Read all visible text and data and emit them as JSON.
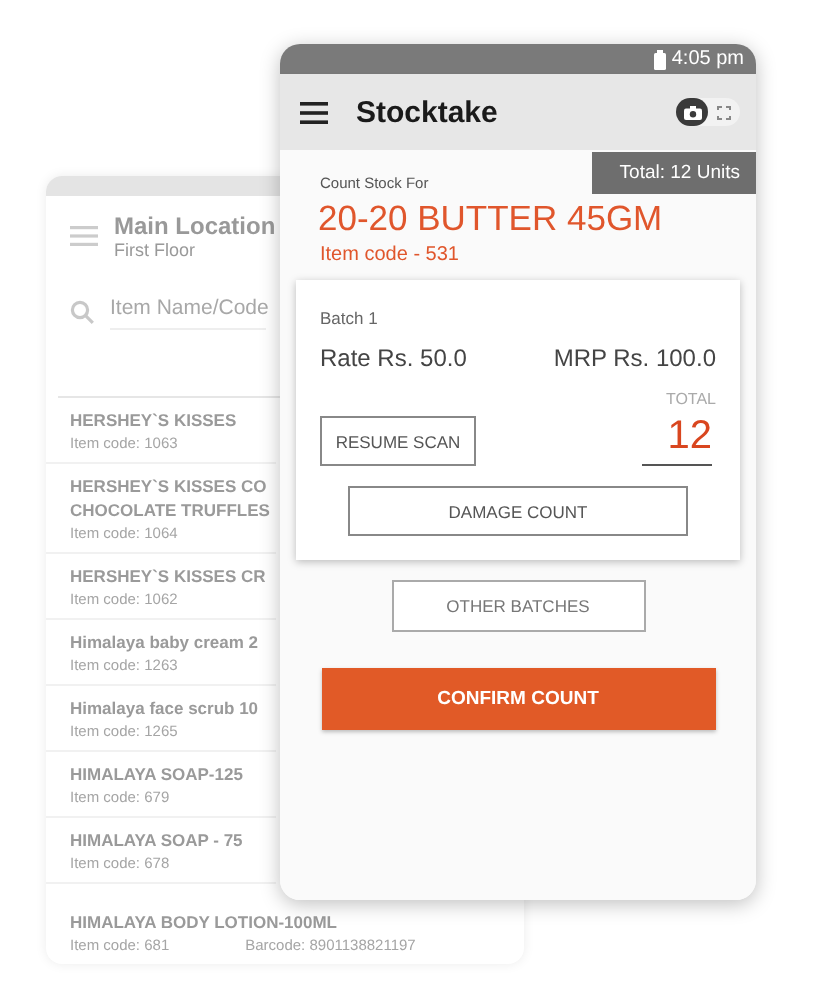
{
  "back_screen": {
    "title": "Main Location",
    "subtitle": "First Floor",
    "search": {
      "placeholder": "Item Name/Code"
    },
    "items": [
      {
        "name": "HERSHEY`S KISSES",
        "code": "Item code: 1063"
      },
      {
        "name": "HERSHEY`S KISSES CO",
        "name_line_2": "CHOCOLATE TRUFFLES",
        "code": "Item code: 1064"
      },
      {
        "name": "HERSHEY`S KISSES CR",
        "code": "Item code: 1062"
      },
      {
        "name": "Himalaya baby cream 2",
        "code": "Item code: 1263"
      },
      {
        "name": "Himalaya face scrub 10",
        "code": "Item code: 1265"
      },
      {
        "name": "HIMALAYA  SOAP-125",
        "code": "Item code: 679"
      },
      {
        "name": "HIMALAYA  SOAP - 75",
        "code": "Item code: 678"
      },
      {
        "name": "HIMALAYA  BODY LOTION-100ML",
        "code": "Item code: 681",
        "barcode": "Barcode: 8901138821197"
      }
    ]
  },
  "status_bar": {
    "time": "4:05 pm"
  },
  "app_bar": {
    "title": "Stocktake",
    "mode_toggle": [
      {
        "kind": "camera",
        "selected": true
      },
      {
        "kind": "scanner",
        "selected": false
      }
    ]
  },
  "total_badge": "Total: 12 Units",
  "item": {
    "caption": "Count Stock For",
    "name": "20-20 BUTTER 45GM",
    "code": "Item code - 531"
  },
  "batch_card": {
    "batch": "Batch 1",
    "rate": "Rate Rs. 50.0",
    "mrp": "MRP Rs. 100.0",
    "total_label": "TOTAL",
    "resume_button": "RESUME SCAN",
    "count_value": "12",
    "damage_button": "DAMAGE COUNT"
  },
  "other_batches_button": "OTHER BATCHES",
  "confirm_button": "CONFIRM COUNT"
}
